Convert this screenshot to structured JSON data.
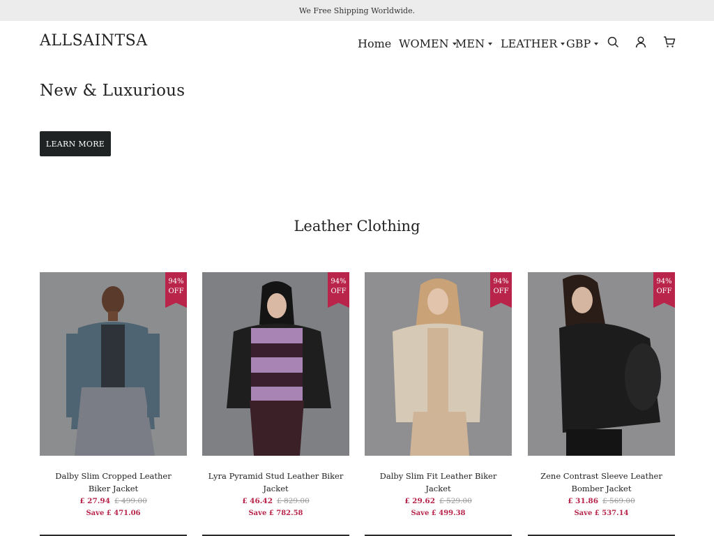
{
  "announcement": "We Free Shipping Worldwide.",
  "header": {
    "logo": "ALLSAINTSA",
    "nav": {
      "home": "Home",
      "women": "WOMEN",
      "men": "MEN",
      "leather": "LEATHER",
      "currency": "GBP"
    },
    "icons": [
      "search-icon",
      "account-icon",
      "cart-icon"
    ]
  },
  "hero": {
    "title": "New & Luxurious",
    "button_label": "LEARN MORE"
  },
  "section": {
    "title": "Leather Clothing"
  },
  "products": [
    {
      "name": "Dalby Slim Cropped Leather Biker Jacket",
      "price": "£ 27.94",
      "old_price": "£ 499.00",
      "save": "Save £ 471.06",
      "badge_pct": "94%",
      "badge_off": "OFF"
    },
    {
      "name": "Lyra Pyramid Stud Leather Biker Jacket",
      "price": "£ 46.42",
      "old_price": "£ 829.00",
      "save": "Save £ 782.58",
      "badge_pct": "94%",
      "badge_off": "OFF"
    },
    {
      "name": "Dalby Slim Fit Leather Biker Jacket",
      "price": "£ 29.62",
      "old_price": "£ 529.00",
      "save": "Save £ 499.38",
      "badge_pct": "94%",
      "badge_off": "OFF"
    },
    {
      "name": "Zene Contrast Sleeve Leather Bomber Jacket",
      "price": "£ 31.86",
      "old_price": "£ 569.00",
      "save": "Save £ 537.14",
      "badge_pct": "94%",
      "badge_off": "OFF"
    }
  ],
  "colors": {
    "accent": "#b8244a",
    "button": "#1f2324",
    "announcement_bg": "#ececec"
  }
}
